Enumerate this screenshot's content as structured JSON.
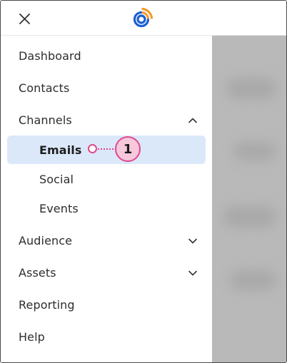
{
  "header": {
    "close_icon": "close-icon",
    "logo_icon": "constant-contact-logo-icon",
    "logo_colors": {
      "blue": "#1a5ed6",
      "orange": "#f29a2e"
    }
  },
  "nav": {
    "dashboard": "Dashboard",
    "contacts": "Contacts",
    "channels": "Channels",
    "channels_chevron": "chevron-up-icon",
    "emails": "Emails",
    "social": "Social",
    "events": "Events",
    "audience": "Audience",
    "audience_chevron": "chevron-down-icon",
    "assets": "Assets",
    "assets_chevron": "chevron-down-icon",
    "reporting": "Reporting",
    "help": "Help"
  },
  "callout": {
    "number": "1",
    "color": "#e0498a",
    "fill": "#f7c8dc"
  },
  "colors": {
    "active_bg": "#dbe8fa",
    "backdrop": "#b9b9b9"
  }
}
